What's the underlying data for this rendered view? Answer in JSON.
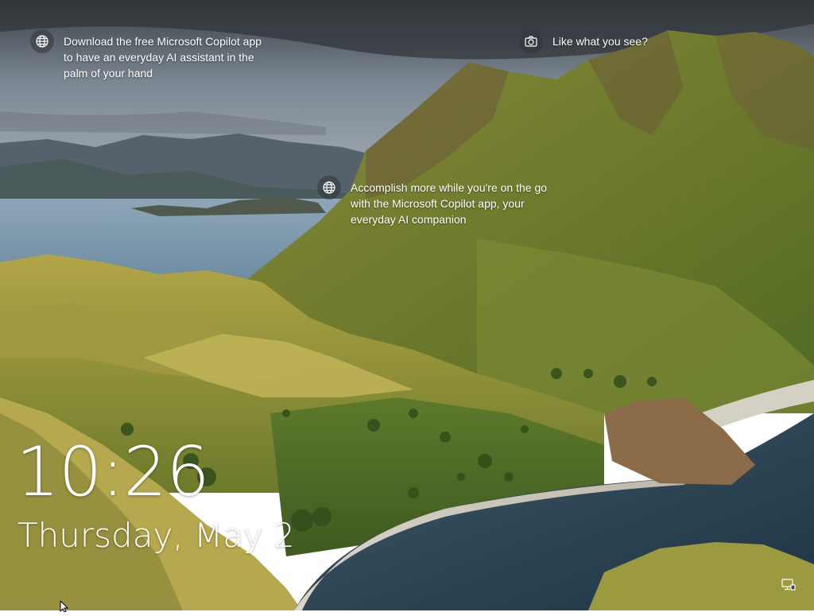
{
  "spotlight": {
    "hotspots": [
      {
        "icon": "globe-icon",
        "text": "Download the free Microsoft Copilot app\nto have an everyday AI assistant in the\npalm of your hand"
      },
      {
        "icon": "globe-icon",
        "text": "Accomplish more while you're on the go\nwith the Microsoft Copilot app, your\neveryday AI companion"
      },
      {
        "icon": "camera-icon",
        "text": "Like what you see?"
      }
    ]
  },
  "lock_screen": {
    "time": "10:26",
    "date": "Thursday, May 2"
  },
  "status": {
    "network_icon": "network-icon"
  }
}
